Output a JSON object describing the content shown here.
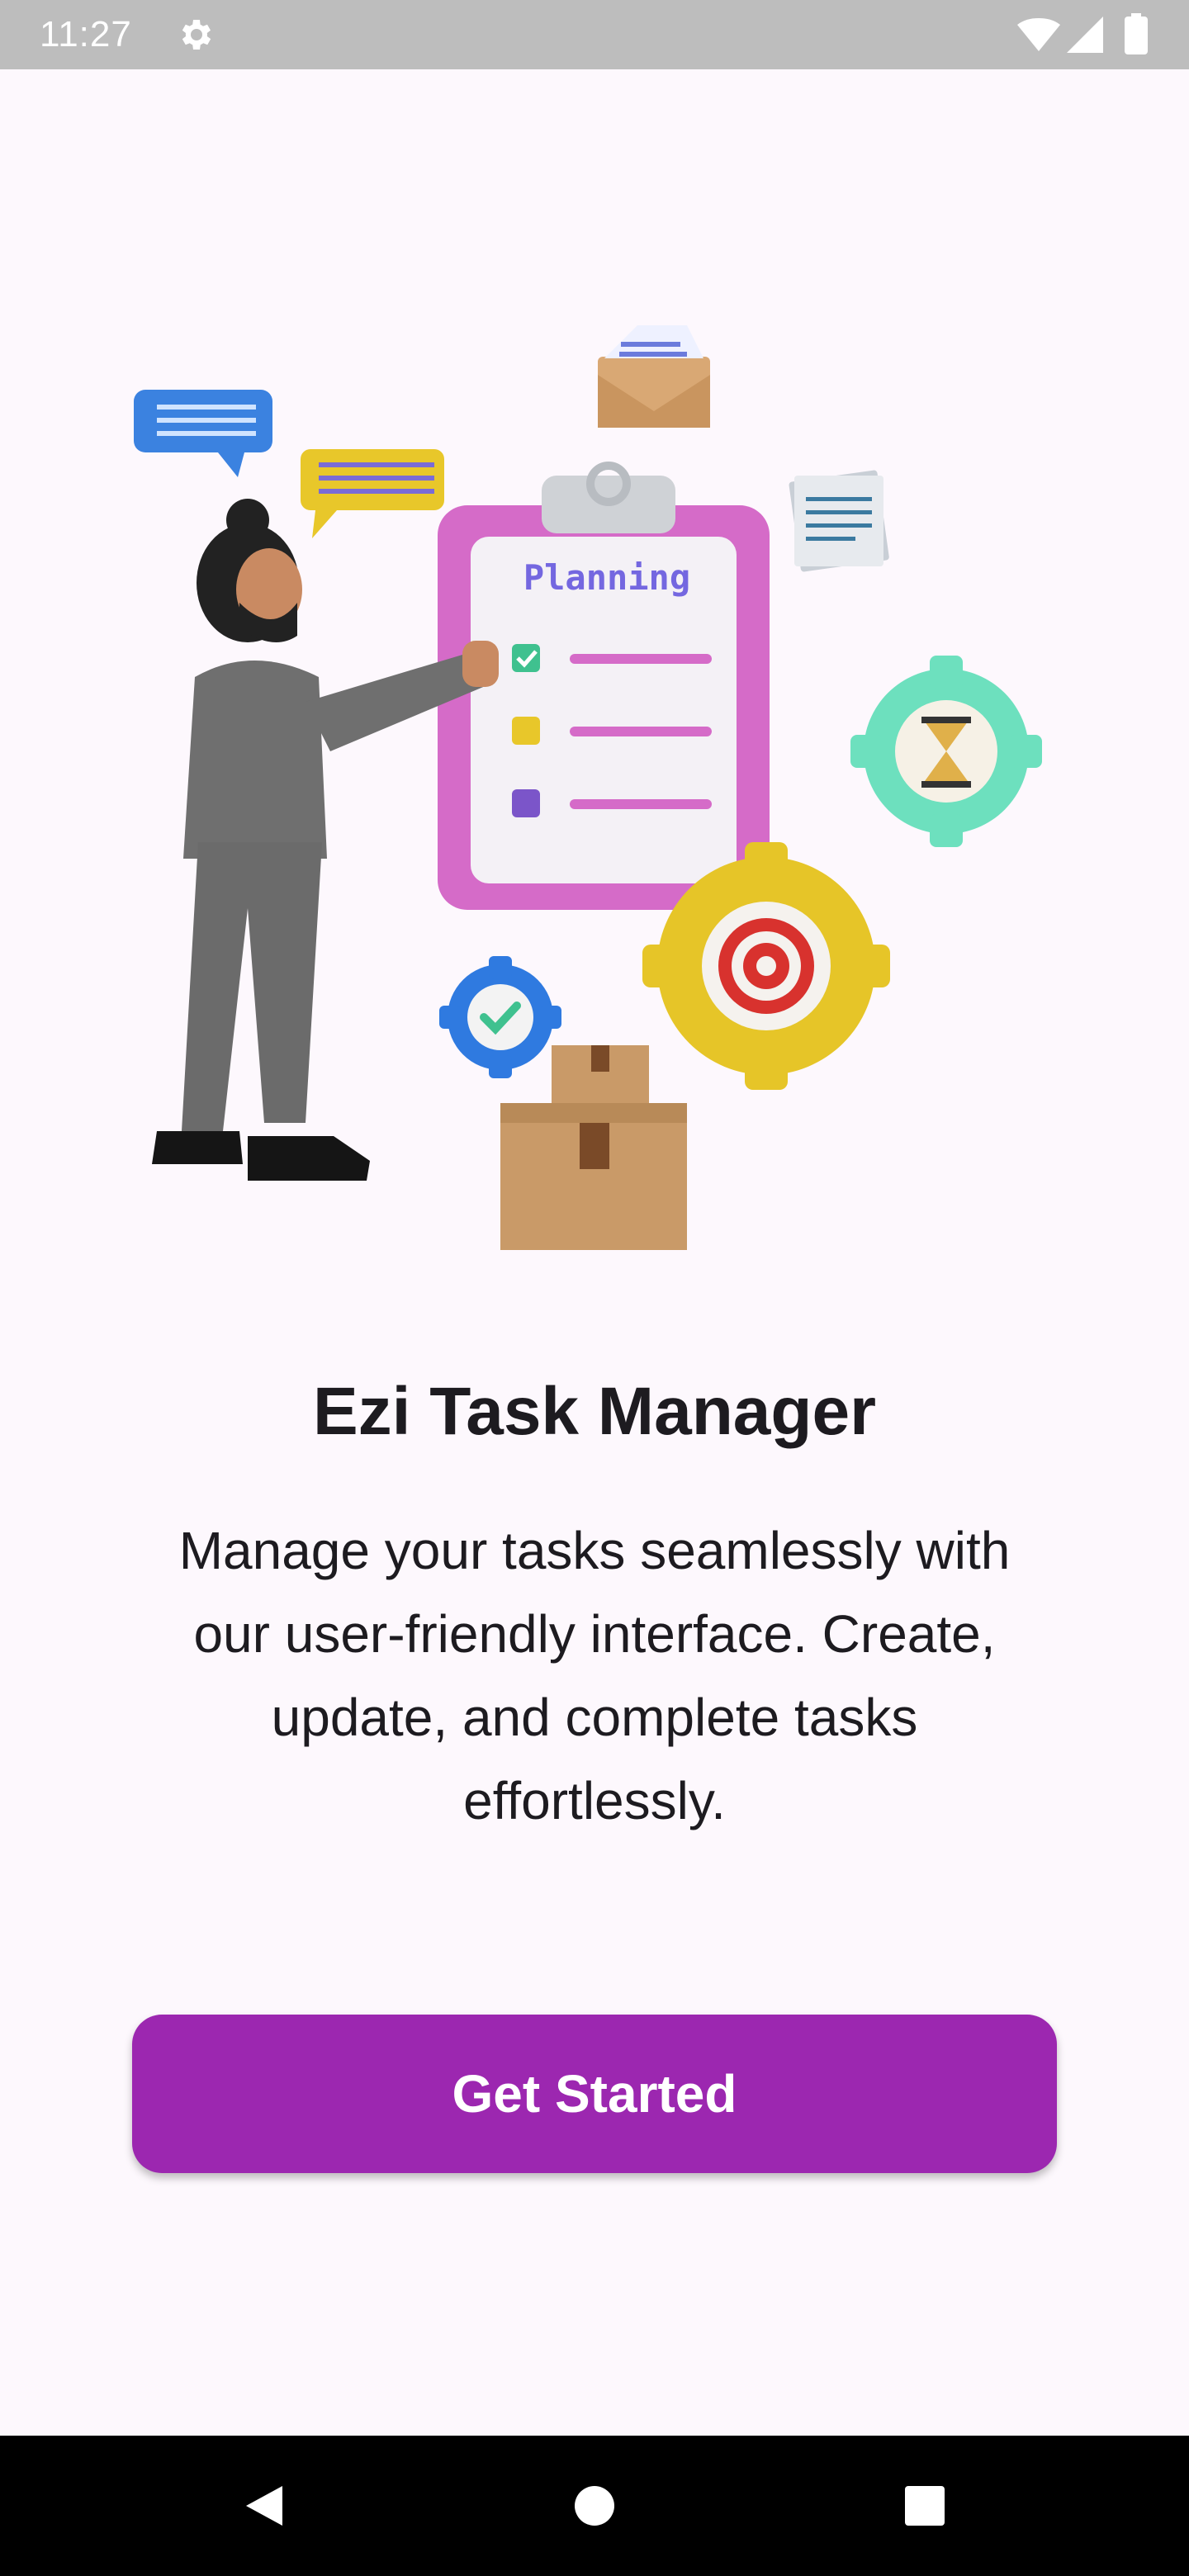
{
  "status_bar": {
    "time": "11:27",
    "icons": [
      "gear-icon",
      "wifi-icon",
      "signal-icon",
      "battery-icon"
    ]
  },
  "hero": {
    "clipboard_heading": "Planning"
  },
  "onboarding": {
    "title": "Ezi Task Manager",
    "description": "Manage your tasks seamlessly with our user-friendly interface. Create, update, and complete tasks effortlessly.",
    "cta_label": "Get Started"
  },
  "nav_bar": {
    "buttons": [
      "back-icon",
      "home-icon",
      "recents-icon"
    ]
  },
  "colors": {
    "accent": "#9c27b0",
    "background": "#fdf8fd",
    "status_bar": "#bdbdbd",
    "nav_bar": "#000000"
  }
}
